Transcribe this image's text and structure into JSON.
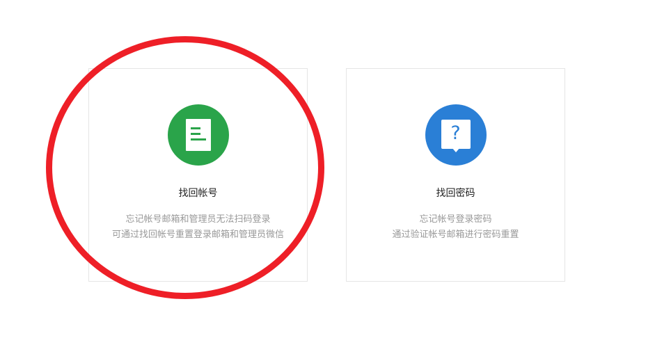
{
  "cards": [
    {
      "title": "找回帐号",
      "line1": "忘记帐号邮箱和管理员无法扫码登录",
      "line2": "可通过找回帐号重置登录邮箱和管理员微信",
      "icon": "document-icon",
      "color": "#2aa44a"
    },
    {
      "title": "找回密码",
      "line1": "忘记帐号登录密码",
      "line2": "通过验证帐号邮箱进行密码重置",
      "icon": "question-bubble-icon",
      "color": "#2a7fd6",
      "symbol": "?"
    }
  ],
  "annotation": {
    "color": "#ee1f27",
    "shape": "ellipse"
  }
}
